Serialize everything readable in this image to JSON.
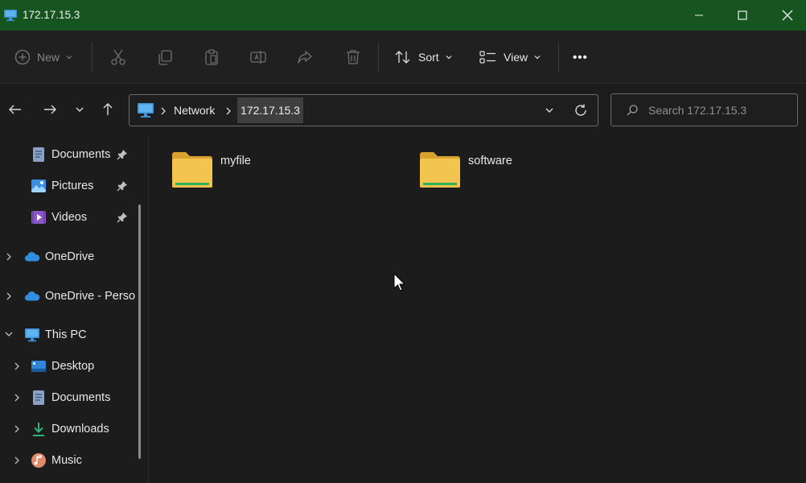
{
  "window": {
    "title": "172.17.15.3",
    "minimize_glyph": "—",
    "maximize_glyph": "☐",
    "close_glyph": "✕"
  },
  "toolbar": {
    "new_label": "New",
    "sort_label": "Sort",
    "view_label": "View",
    "more_glyph": "•••"
  },
  "address": {
    "crumbs": [
      "Network",
      "172.17.15.3"
    ],
    "search_placeholder": "Search 172.17.15.3"
  },
  "sidebar": {
    "items": [
      {
        "label": "Documents",
        "icon": "documents-icon",
        "pinned": true
      },
      {
        "label": "Pictures",
        "icon": "pictures-icon",
        "pinned": true
      },
      {
        "label": "Videos",
        "icon": "videos-icon",
        "pinned": true
      },
      {
        "label": "OneDrive",
        "icon": "onedrive-icon"
      },
      {
        "label": "OneDrive - Perso",
        "icon": "onedrive-icon"
      },
      {
        "label": "This PC",
        "icon": "this-pc-icon",
        "expanded": true
      },
      {
        "label": "Desktop",
        "icon": "desktop-icon"
      },
      {
        "label": "Documents",
        "icon": "documents-icon"
      },
      {
        "label": "Downloads",
        "icon": "downloads-icon"
      },
      {
        "label": "Music",
        "icon": "music-icon"
      }
    ]
  },
  "content": {
    "folders": [
      {
        "name": "myfile",
        "icon": "folder-icon"
      },
      {
        "name": "software",
        "icon": "folder-icon"
      }
    ]
  },
  "colors": {
    "titlebar": "#16551f",
    "folder_yellow": "#f4c54e",
    "accent_blue": "#4aa3e8"
  }
}
